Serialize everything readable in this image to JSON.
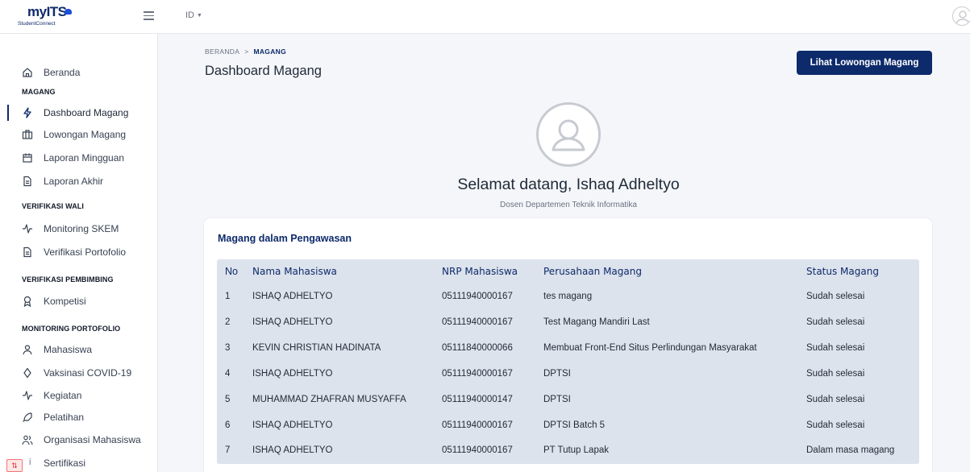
{
  "topbar": {
    "logo_main": "myITS",
    "logo_sub": "StudentConnect",
    "language": "ID"
  },
  "sidebar": {
    "home": "Beranda",
    "sections": [
      {
        "title": "MAGANG",
        "items": [
          "Dashboard Magang",
          "Lowongan Magang",
          "Laporan Mingguan",
          "Laporan Akhir"
        ]
      },
      {
        "title": "VERIFIKASI WALI",
        "items": [
          "Monitoring SKEM",
          "Verifikasi Portofolio"
        ]
      },
      {
        "title": "VERIFIKASI PEMBIMBING",
        "items": [
          "Kompetisi"
        ]
      },
      {
        "title": "MONITORING PORTOFOLIO",
        "items": [
          "Mahasiswa",
          "Vaksinasi COVID-19",
          "Kegiatan",
          "Pelatihan",
          "Organisasi Mahasiswa",
          "Sertifikasi"
        ]
      }
    ],
    "active_item": "Dashboard Magang"
  },
  "main": {
    "breadcrumb": [
      "BERANDA",
      "MAGANG"
    ],
    "title": "Dashboard Magang",
    "cta_label": "Lihat Lowongan Magang",
    "welcome": "Selamat datang, Ishaq Adheltyo",
    "role": "Dosen Departemen Teknik Informatika"
  },
  "table": {
    "title": "Magang dalam Pengawasan",
    "headers": [
      "No",
      "Nama Mahasiswa",
      "NRP Mahasiswa",
      "Perusahaan Magang",
      "Status Magang"
    ],
    "rows": [
      [
        "1",
        "ISHAQ ADHELTYO",
        "05111940000167",
        "tes magang",
        "Sudah selesai"
      ],
      [
        "2",
        "ISHAQ ADHELTYO",
        "05111940000167",
        "Test Magang Mandiri Last",
        "Sudah selesai"
      ],
      [
        "3",
        "KEVIN CHRISTIAN HADINATA",
        "05111840000066",
        "Membuat Front-End Situs Perlindungan Masyarakat",
        "Sudah selesai"
      ],
      [
        "4",
        "ISHAQ ADHELTYO",
        "05111940000167",
        "DPTSI",
        "Sudah selesai"
      ],
      [
        "5",
        "MUHAMMAD ZHAFRAN MUSYAFFA",
        "05111940000147",
        "DPTSI",
        "Sudah selesai"
      ],
      [
        "6",
        "ISHAQ ADHELTYO",
        "05111940000167",
        "DPTSI Batch 5",
        "Sudah selesai"
      ],
      [
        "7",
        "ISHAQ ADHELTYO",
        "05111940000167",
        "PT Tutup Lapak",
        "Dalam masa magang"
      ]
    ]
  },
  "colors": {
    "primary": "#0d2a6b",
    "table_bg": "#dde3ec",
    "page_bg": "#f4f6f9"
  }
}
